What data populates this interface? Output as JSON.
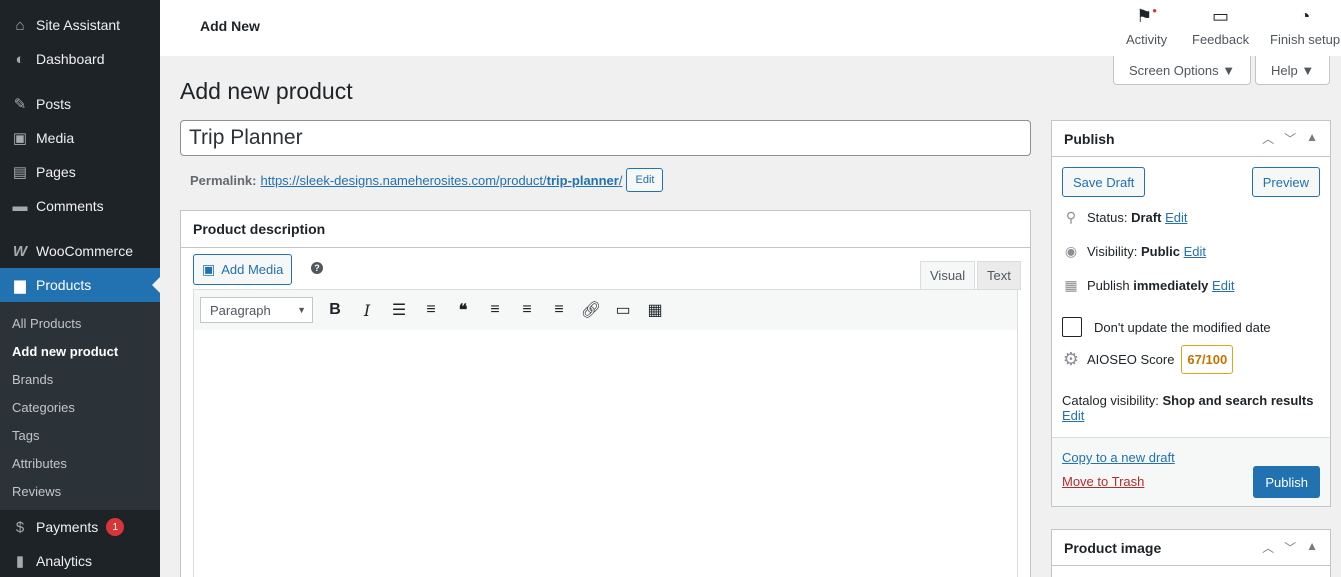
{
  "sidebar": {
    "top_items": [
      {
        "label": "Site Assistant",
        "icon": "home-icon"
      },
      {
        "label": "Dashboard",
        "icon": "dashboard-icon"
      },
      {
        "label": "Posts",
        "icon": "pin-icon"
      },
      {
        "label": "Media",
        "icon": "media-icon"
      },
      {
        "label": "Pages",
        "icon": "pages-icon"
      },
      {
        "label": "Comments",
        "icon": "comment-icon"
      },
      {
        "label": "WooCommerce",
        "icon": "woocommerce-icon"
      },
      {
        "label": "Products",
        "icon": "products-icon"
      }
    ],
    "submenu": [
      "All Products",
      "Add new product",
      "Brands",
      "Categories",
      "Tags",
      "Attributes",
      "Reviews"
    ],
    "bottom_items": [
      {
        "label": "Payments",
        "icon": "payments-icon",
        "badge": "1"
      },
      {
        "label": "Analytics",
        "icon": "analytics-icon"
      }
    ]
  },
  "topbar": {
    "title": "Add New",
    "actions": {
      "activity": "Activity",
      "feedback": "Feedback",
      "finish_setup": "Finish setup"
    }
  },
  "screen_options": "Screen Options ▼",
  "help": "Help ▼",
  "page_title": "Add new product",
  "product_title": "Trip Planner",
  "permalink": {
    "label": "Permalink:",
    "url_base": "https://sleek-designs.nameherosites.com/product/",
    "slug": "trip-planner",
    "url_end": "/",
    "edit": "Edit"
  },
  "editor": {
    "heading": "Product description",
    "add_media": "Add Media",
    "help": "?",
    "tabs": {
      "visual": "Visual",
      "text": "Text"
    },
    "format": "Paragraph"
  },
  "publish": {
    "heading": "Publish",
    "save_draft": "Save Draft",
    "preview": "Preview",
    "status_label": "Status:",
    "status_value": "Draft",
    "visibility_label": "Visibility:",
    "visibility_value": "Public",
    "publish_label": "Publish",
    "publish_value": "immediately",
    "edit": "Edit",
    "dont_update": "Don't update the modified date",
    "aioseo_label": "AIOSEO Score",
    "aioseo_score": "67/100",
    "catalog_label": "Catalog visibility:",
    "catalog_value": "Shop and search results",
    "copy_draft": "Copy to a new draft",
    "trash": "Move to Trash",
    "publish_btn": "Publish"
  },
  "product_image": {
    "heading": "Product image"
  },
  "colors": {
    "accent": "#2271b1",
    "sidebar": "#1d2327",
    "badge": "#d63638",
    "score": "#dba617"
  }
}
